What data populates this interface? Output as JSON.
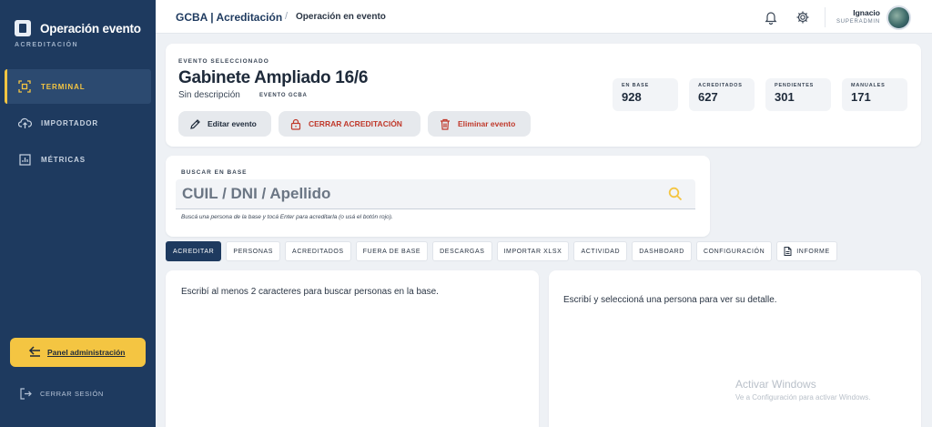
{
  "sidebar": {
    "brand_title": "Operación evento",
    "brand_subtitle": "ACREDITACIÓN",
    "items": [
      {
        "label": "TERMINAL",
        "icon": "grid-scan-icon",
        "active": true
      },
      {
        "label": "IMPORTADOR",
        "icon": "cloud-upload-icon",
        "active": false
      },
      {
        "label": "MÉTRICAS",
        "icon": "bar-chart-icon",
        "active": false
      }
    ],
    "admin_button": "Panel administración",
    "logout": "CERRAR SESIÓN"
  },
  "header": {
    "title": "GCBA | Acreditación",
    "separator": "/",
    "breadcrumb": "Operación en evento",
    "user_name": "Ignacio",
    "user_role": "SUPERADMIN"
  },
  "event": {
    "label": "EVENTO SELECCIONADO",
    "title": "Gabinete Ampliado 16/6",
    "description": "Sin descripción",
    "tag": "EVENTO GCBA",
    "buttons": {
      "edit": "Editar evento",
      "close": "CERRAR ACREDITACIÓN",
      "delete": "Eliminar evento"
    },
    "stats": [
      {
        "label": "EN BASE",
        "value": "928"
      },
      {
        "label": "ACREDITADOS",
        "value": "627"
      },
      {
        "label": "PENDIENTES",
        "value": "301"
      },
      {
        "label": "MANUALES",
        "value": "171"
      }
    ]
  },
  "search": {
    "label": "BUSCAR EN BASE",
    "placeholder": "CUIL / DNI / Apellido",
    "help": "Buscá una persona de la base y tocá Enter para acreditarla (o usá el botón rojo)."
  },
  "tabs": [
    {
      "label": "ACREDITAR",
      "active": true
    },
    {
      "label": "PERSONAS",
      "active": false
    },
    {
      "label": "ACREDITADOS",
      "active": false
    },
    {
      "label": "FUERA DE BASE",
      "active": false
    },
    {
      "label": "DESCARGAS",
      "active": false
    },
    {
      "label": "IMPORTAR XLSX",
      "active": false
    },
    {
      "label": "ACTIVIDAD",
      "active": false
    },
    {
      "label": "DASHBOARD",
      "active": false
    },
    {
      "label": "CONFIGURACIÓN",
      "active": false
    },
    {
      "label": "INFORME",
      "active": false,
      "icon": "document-icon"
    }
  ],
  "panels": {
    "left_text": "Escribí al menos 2 caracteres para buscar personas en la base.",
    "right_text": "Escribí y seleccioná una persona para ver su detalle."
  },
  "watermark": {
    "line1": "Activar Windows",
    "line2": "Ve a Configuración para activar Windows."
  },
  "colors": {
    "sidebar": "#1e3a5f",
    "accent": "#f4c542",
    "danger": "#c0392b"
  }
}
